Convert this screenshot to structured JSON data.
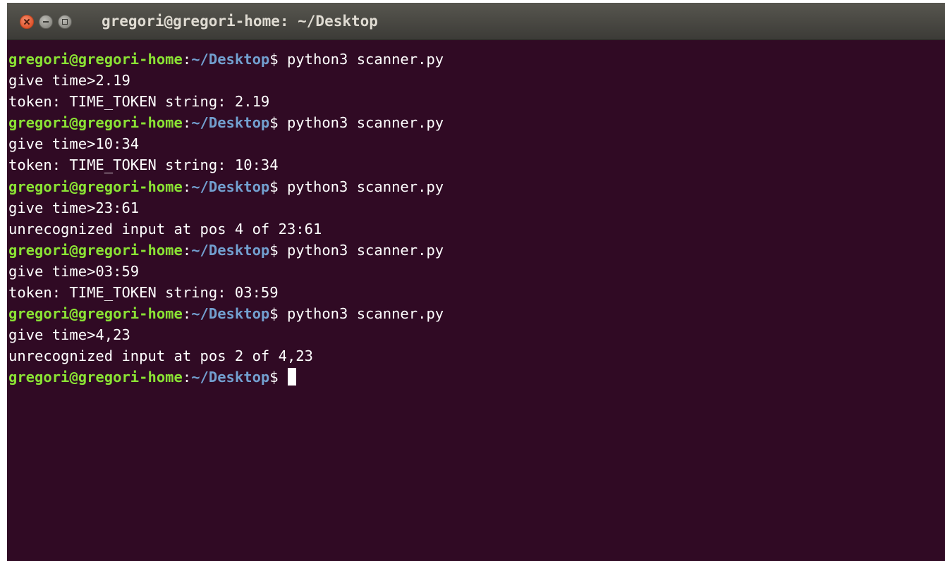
{
  "window": {
    "title": "gregori@gregori-home: ~/Desktop",
    "colors": {
      "background": "#300a24",
      "user": "#8ae234",
      "path": "#729fcf",
      "text": "#ffffff"
    }
  },
  "terminal": {
    "prompt": {
      "user": "gregori@gregori-home",
      "sep": ":",
      "path": "~/Desktop",
      "symbol": "$ "
    },
    "lines": [
      {
        "type": "prompt",
        "command": "python3 scanner.py"
      },
      {
        "type": "output",
        "text": "give time>2.19"
      },
      {
        "type": "output",
        "text": "token: TIME_TOKEN string: 2.19"
      },
      {
        "type": "prompt",
        "command": "python3 scanner.py"
      },
      {
        "type": "output",
        "text": "give time>10:34"
      },
      {
        "type": "output",
        "text": "token: TIME_TOKEN string: 10:34"
      },
      {
        "type": "prompt",
        "command": "python3 scanner.py"
      },
      {
        "type": "output",
        "text": "give time>23:61"
      },
      {
        "type": "output",
        "text": "unrecognized input at pos 4 of 23:61"
      },
      {
        "type": "prompt",
        "command": "python3 scanner.py"
      },
      {
        "type": "output",
        "text": "give time>03:59"
      },
      {
        "type": "output",
        "text": "token: TIME_TOKEN string: 03:59"
      },
      {
        "type": "prompt",
        "command": "python3 scanner.py"
      },
      {
        "type": "output",
        "text": "give time>4,23"
      },
      {
        "type": "output",
        "text": "unrecognized input at pos 2 of 4,23"
      },
      {
        "type": "prompt",
        "command": "",
        "cursor": true
      }
    ]
  }
}
